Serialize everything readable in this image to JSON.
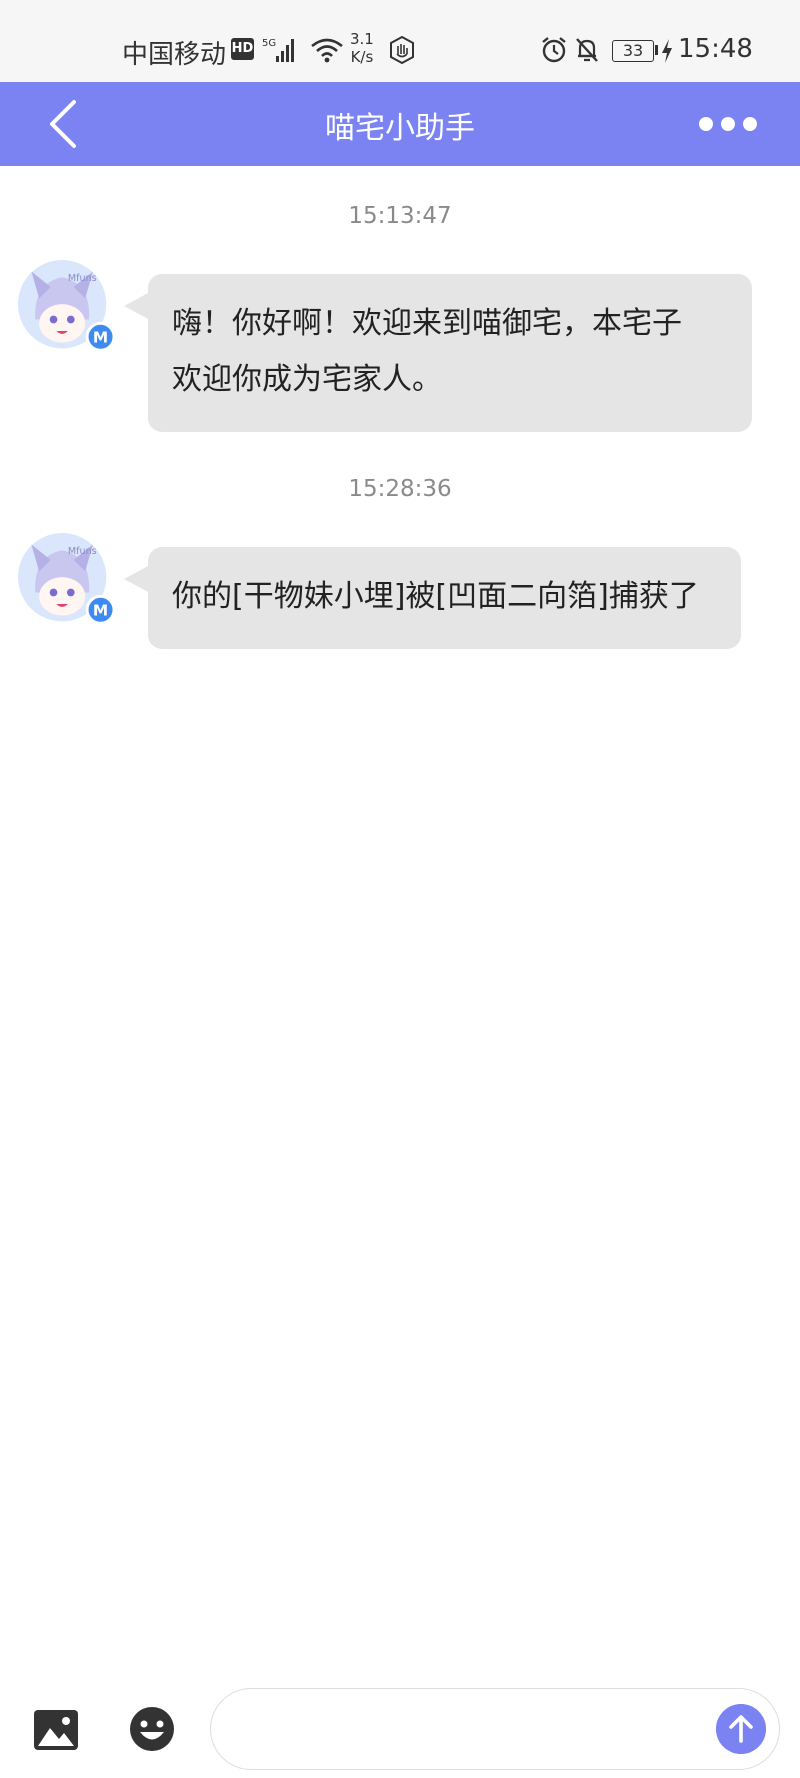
{
  "status_bar": {
    "carrier": "中国移动",
    "hd": "HD",
    "network": "5G",
    "speed_value": "3.1",
    "speed_unit": "K/s",
    "battery": "33",
    "time": "15:48"
  },
  "header": {
    "title": "喵宅小助手"
  },
  "messages": [
    {
      "time": "15:13:47",
      "text_line1": "嗨！你好啊！欢迎来到喵御宅，本宅子",
      "text_line2": "欢迎你成为宅家人。",
      "avatar_text": "Mfuns",
      "badge": "M"
    },
    {
      "time": "15:28:36",
      "text_line1": "你的[干物妹小埋]被[凹面二向箔]捕获了",
      "avatar_text": "Mfuns",
      "badge": "M"
    }
  ],
  "input": {
    "placeholder": ""
  },
  "colors": {
    "accent": "#7b83f2",
    "bubble": "#e5e5e5",
    "timestamp": "#8a8a8a"
  },
  "icons": [
    "back-arrow-icon",
    "more-dots-icon",
    "image-icon",
    "emoji-icon",
    "send-arrow-icon",
    "alarm-icon",
    "mute-bell-icon",
    "wifi-icon",
    "signal-icon",
    "hand-icon",
    "charging-bolt-icon"
  ]
}
